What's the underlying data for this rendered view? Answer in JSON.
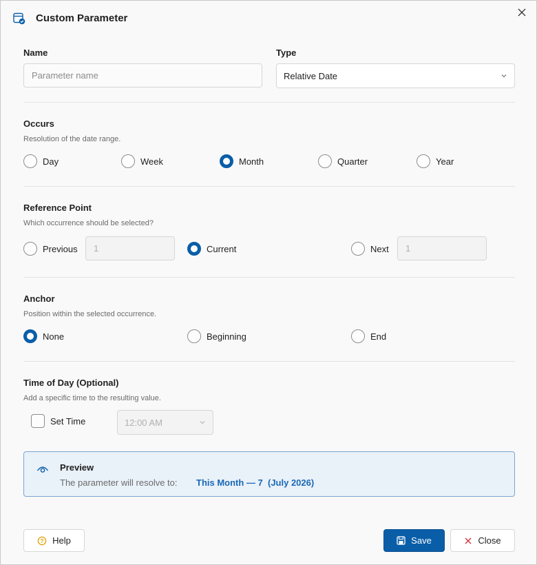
{
  "window": {
    "title": "Custom Parameter"
  },
  "name_field": {
    "label": "Name",
    "placeholder": "Parameter name",
    "value": ""
  },
  "type_field": {
    "label": "Type",
    "value": "Relative Date"
  },
  "occurs": {
    "title": "Occurs",
    "hint": "Resolution of the date range.",
    "options": [
      "Day",
      "Week",
      "Month",
      "Quarter",
      "Year"
    ],
    "selected": "Month"
  },
  "reference_point": {
    "title": "Reference Point",
    "hint": "Which occurrence should be selected?",
    "previous_label": "Previous",
    "previous_value": "1",
    "current_label": "Current",
    "next_label": "Next",
    "next_value": "1",
    "selected": "Current"
  },
  "anchor": {
    "title": "Anchor",
    "hint": "Position within the selected occurrence.",
    "options": [
      "None",
      "Beginning",
      "End"
    ],
    "selected": "None"
  },
  "time_of_day": {
    "title": "Time of Day (Optional)",
    "hint": "Add a specific time to the resulting value.",
    "checkbox_label": "Set Time",
    "checked": false,
    "time_value": "12:00 AM"
  },
  "preview": {
    "title": "Preview",
    "text": "The parameter will resolve to:",
    "value": "This Month — 7  (July 2026)"
  },
  "buttons": {
    "help": "Help",
    "save": "Save",
    "close": "Close"
  },
  "colors": {
    "accent": "#0a5ea8",
    "preview_bg": "#e9f1f9",
    "preview_value": "#1a68b5",
    "help_icon": "#e0a100",
    "close_icon": "#d13438"
  }
}
